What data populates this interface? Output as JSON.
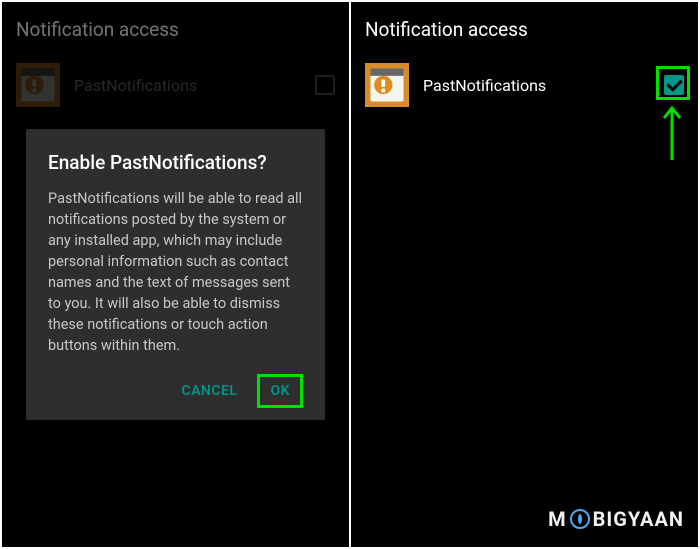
{
  "left": {
    "header": "Notification access",
    "app": {
      "name": "PastNotifications",
      "checked": false
    },
    "dialog": {
      "title": "Enable PastNotifications?",
      "body": "PastNotifications will be able to read all notifications posted by the system or any installed app, which may include personal information such as contact names and the text of messages sent to you. It will also be able to dismiss these notifications or touch action buttons within them.",
      "cancel": "CANCEL",
      "ok": "OK"
    }
  },
  "right": {
    "header": "Notification access",
    "app": {
      "name": "PastNotifications",
      "checked": true
    }
  },
  "watermark": {
    "pre": "M",
    "post": "BIGYAAN"
  }
}
